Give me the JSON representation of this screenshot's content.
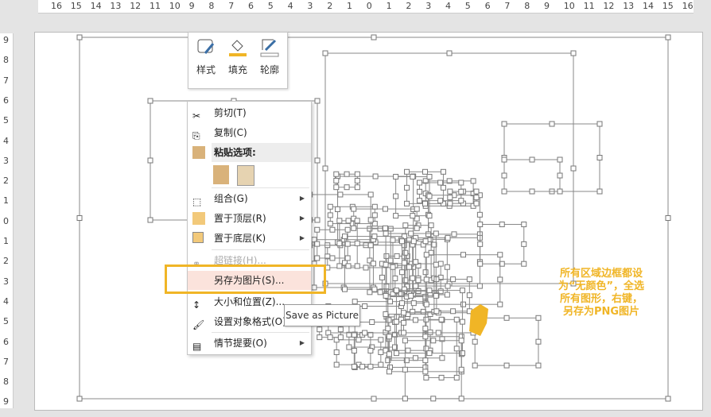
{
  "ruler": {
    "horizontal": [
      "16",
      "15",
      "14",
      "13",
      "12",
      "11",
      "10",
      "9",
      "8",
      "7",
      "6",
      "5",
      "4",
      "3",
      "2",
      "1",
      "0",
      "1",
      "2",
      "3",
      "4",
      "5",
      "6",
      "7",
      "8",
      "9",
      "10",
      "11",
      "12",
      "13",
      "14",
      "15",
      "16"
    ],
    "vertical": [
      "9",
      "8",
      "7",
      "6",
      "5",
      "4",
      "3",
      "2",
      "1",
      "0",
      "1",
      "2",
      "3",
      "4",
      "5",
      "6",
      "7",
      "8",
      "9"
    ]
  },
  "mini_toolbar": {
    "style": "样式",
    "fill": "填充",
    "outline": "轮廓"
  },
  "menu": {
    "cut": "剪切(T)",
    "copy": "复制(C)",
    "paste_options": "粘贴选项:",
    "group": "组合(G)",
    "bring_front": "置于顶层(R)",
    "send_back": "置于底层(K)",
    "hyperlink": "超链接(H)...",
    "save_as_picture": "另存为图片(S)...",
    "size_position": "大小和位置(Z)...",
    "format_object": "设置对象格式(O)...",
    "outline": "情节提要(O)"
  },
  "tooltip": "Save as Picture",
  "annotation": "所有区域边框都设为“无颜色”，全选所有图形，右键，另存为PNG图片",
  "colors": {
    "accent": "#f0b526"
  }
}
